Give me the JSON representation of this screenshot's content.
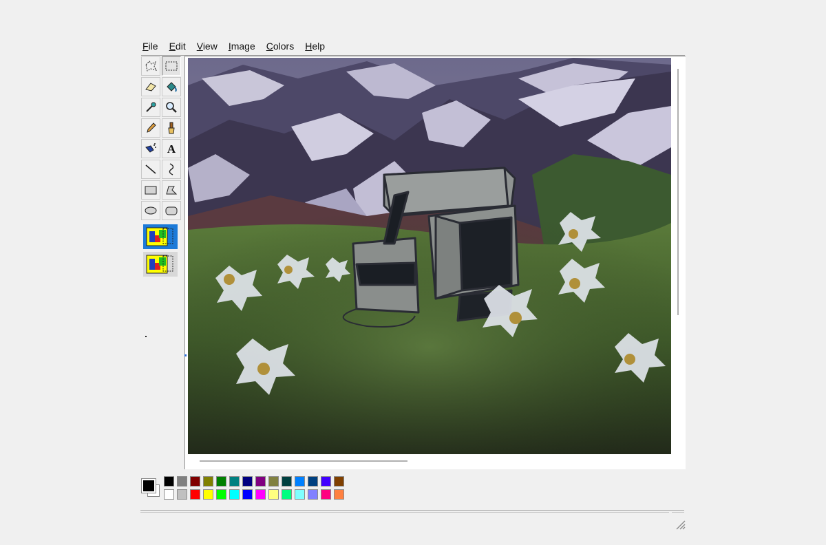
{
  "menu": {
    "items": [
      {
        "first": "F",
        "rest": "ile"
      },
      {
        "first": "E",
        "rest": "dit"
      },
      {
        "first": "V",
        "rest": "iew"
      },
      {
        "first": "I",
        "rest": "mage"
      },
      {
        "first": "C",
        "rest": "olors"
      },
      {
        "first": "H",
        "rest": "elp"
      }
    ]
  },
  "tools": [
    {
      "name": "free-form-select-icon"
    },
    {
      "name": "rect-select-icon",
      "pressed": true
    },
    {
      "name": "eraser-icon"
    },
    {
      "name": "fill-bucket-icon"
    },
    {
      "name": "color-picker-icon"
    },
    {
      "name": "magnifier-icon"
    },
    {
      "name": "pencil-icon"
    },
    {
      "name": "brush-icon"
    },
    {
      "name": "airbrush-icon"
    },
    {
      "name": "text-icon",
      "glyph": "A"
    },
    {
      "name": "line-icon"
    },
    {
      "name": "curve-icon"
    },
    {
      "name": "rectangle-icon"
    },
    {
      "name": "polygon-icon"
    },
    {
      "name": "ellipse-icon"
    },
    {
      "name": "rounded-rect-icon"
    }
  ],
  "selection_options": [
    {
      "name": "opaque-selection-option",
      "selected": true
    },
    {
      "name": "transparent-selection-option",
      "selected": false
    }
  ],
  "current_colors": {
    "foreground": "#000000",
    "background": "#ffffff"
  },
  "palette": {
    "top": [
      "#000000",
      "#808080",
      "#800000",
      "#808000",
      "#008000",
      "#008080",
      "#000080",
      "#800080",
      "#808040",
      "#004040",
      "#0080ff",
      "#004080",
      "#4000ff",
      "#804000"
    ],
    "bottom": [
      "#ffffff",
      "#c0c0c0",
      "#ff0000",
      "#ffff00",
      "#00ff00",
      "#00ffff",
      "#0000ff",
      "#ff00ff",
      "#ffff80",
      "#00ff80",
      "#80ffff",
      "#8080ff",
      "#ff0080",
      "#ff8040"
    ]
  },
  "canvas": {
    "description_colors": {
      "sky": "#9a8aa6",
      "mountain": "#5a5470",
      "snow": "#c8c4d8",
      "grass": "#4a6430",
      "device": "#8a8e8c"
    }
  }
}
